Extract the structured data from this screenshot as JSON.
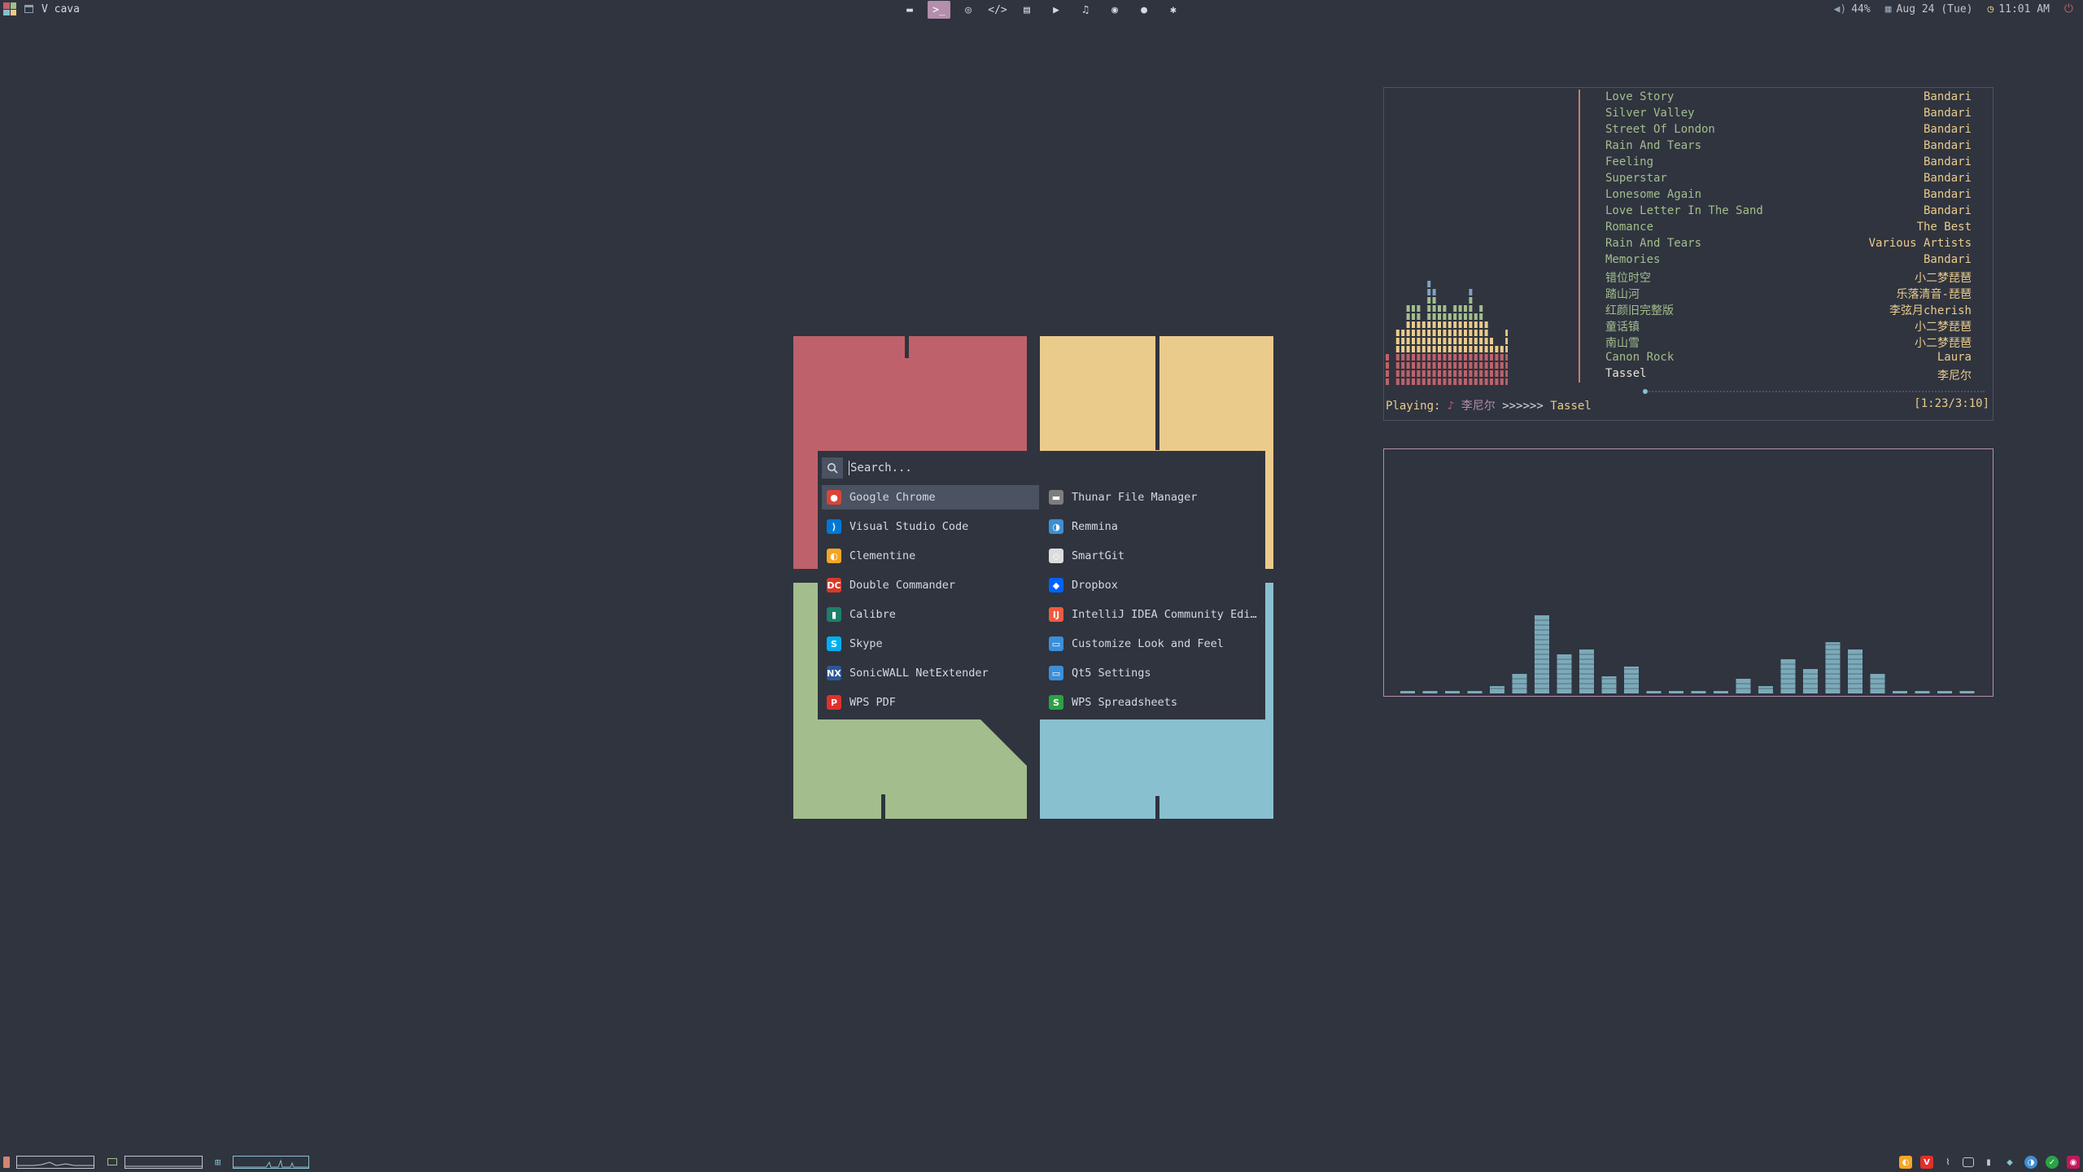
{
  "topbar": {
    "window_title": "V cava",
    "apps": [
      {
        "icon": "folder-icon",
        "glyph": "▬"
      },
      {
        "icon": "terminal-icon",
        "glyph": ">_",
        "active": true
      },
      {
        "icon": "browser-icon",
        "glyph": "◎"
      },
      {
        "icon": "code-icon",
        "glyph": "</>"
      },
      {
        "icon": "document-icon",
        "glyph": "▤"
      },
      {
        "icon": "video-icon",
        "glyph": "▶"
      },
      {
        "icon": "music-icon",
        "glyph": "♫"
      },
      {
        "icon": "github-icon",
        "glyph": "◉"
      },
      {
        "icon": "chat-icon",
        "glyph": "●"
      },
      {
        "icon": "settings-icon",
        "glyph": "✱"
      }
    ],
    "volume": "44%",
    "date": "Aug 24 (Tue)",
    "time": "11:01 AM"
  },
  "launcher": {
    "search_placeholder": "Search...",
    "apps_left": [
      {
        "label": "Google Chrome",
        "icon": "chrome-icon",
        "color": "#db4437",
        "glyph": "●",
        "selected": true
      },
      {
        "label": "Visual Studio Code",
        "icon": "vscode-icon",
        "color": "#0078d4",
        "glyph": "⟩"
      },
      {
        "label": "Clementine",
        "icon": "clementine-icon",
        "color": "#f5a623",
        "glyph": "◐"
      },
      {
        "label": "Double Commander",
        "icon": "double-commander-icon",
        "color": "#d9382b",
        "glyph": "DC"
      },
      {
        "label": "Calibre",
        "icon": "calibre-icon",
        "color": "#1d7f6a",
        "glyph": "▮"
      },
      {
        "label": "Skype",
        "icon": "skype-icon",
        "color": "#00aff0",
        "glyph": "S"
      },
      {
        "label": "SonicWALL NetExtender",
        "icon": "sonicwall-icon",
        "color": "#2b5797",
        "glyph": "NX"
      },
      {
        "label": "WPS PDF",
        "icon": "wps-pdf-icon",
        "color": "#e0302b",
        "glyph": "P"
      }
    ],
    "apps_right": [
      {
        "label": "Thunar File Manager",
        "icon": "thunar-icon",
        "color": "#7d7d7d",
        "glyph": "▬"
      },
      {
        "label": "Remmina",
        "icon": "remmina-icon",
        "color": "#3e8ed0",
        "glyph": "◑"
      },
      {
        "label": "SmartGit",
        "icon": "smartgit-icon",
        "color": "#dcdcdc",
        "glyph": "◇"
      },
      {
        "label": "Dropbox",
        "icon": "dropbox-icon",
        "color": "#0061ff",
        "glyph": "◆"
      },
      {
        "label": "IntelliJ IDEA Community Edi…",
        "icon": "intellij-icon",
        "color": "#f05a3f",
        "glyph": "IJ"
      },
      {
        "label": "Customize Look and Feel",
        "icon": "customize-icon",
        "color": "#3b8ed8",
        "glyph": "▭"
      },
      {
        "label": "Qt5 Settings",
        "icon": "qt5-icon",
        "color": "#3b8ed8",
        "glyph": "▭"
      },
      {
        "label": "WPS Spreadsheets",
        "icon": "wps-spreadsheets-icon",
        "color": "#2ba245",
        "glyph": "S"
      }
    ]
  },
  "player": {
    "playlist": [
      {
        "title": "Love Story",
        "artist": "Bandari"
      },
      {
        "title": "Silver Valley",
        "artist": "Bandari"
      },
      {
        "title": "Street Of London",
        "artist": "Bandari"
      },
      {
        "title": "Rain And Tears",
        "artist": "Bandari"
      },
      {
        "title": "Feeling",
        "artist": "Bandari"
      },
      {
        "title": "Superstar",
        "artist": "Bandari"
      },
      {
        "title": "Lonesome Again",
        "artist": "Bandari"
      },
      {
        "title": "Love Letter In The Sand",
        "artist": "Bandari"
      },
      {
        "title": "Romance",
        "artist": "The Best"
      },
      {
        "title": "Rain And Tears",
        "artist": "Various Artists"
      },
      {
        "title": "Memories",
        "artist": "Bandari"
      },
      {
        "title": "错位时空",
        "artist": "小二梦琵琶"
      },
      {
        "title": "踏山河",
        "artist": "乐落清音-琵琶"
      },
      {
        "title": "红颜旧完整版",
        "artist": "李弦月cherish"
      },
      {
        "title": "童话镇",
        "artist": "小二梦琵琶"
      },
      {
        "title": "南山雪",
        "artist": "小二梦琵琶"
      },
      {
        "title": "Canon Rock",
        "artist": "Laura"
      },
      {
        "title": "Tassel",
        "artist": "李尼尔",
        "current": true
      }
    ],
    "status": {
      "label": "Playing:",
      "note": "♪",
      "artist": "李尼尔",
      "arrows": ">>>>>>",
      "title": "Tassel",
      "time": "[1:23/3:10]"
    },
    "visualizer_levels": [
      4,
      0,
      7,
      7,
      10,
      10,
      10,
      8,
      13,
      12,
      10,
      10,
      9,
      10,
      10,
      10,
      12,
      9,
      10,
      8,
      6,
      5,
      5,
      7
    ]
  },
  "cava": {
    "bar_levels": [
      1,
      1,
      1,
      1,
      3,
      8,
      32,
      16,
      18,
      7,
      11,
      1,
      1,
      1,
      1,
      6,
      3,
      14,
      10,
      21,
      18,
      8,
      1,
      1,
      1,
      1
    ]
  },
  "colors": {
    "background": "#2f343f",
    "red": "#bf616a",
    "yellow": "#ebcb8b",
    "green": "#a3be8c",
    "blue": "#88c0d0",
    "purple": "#b48ead"
  }
}
